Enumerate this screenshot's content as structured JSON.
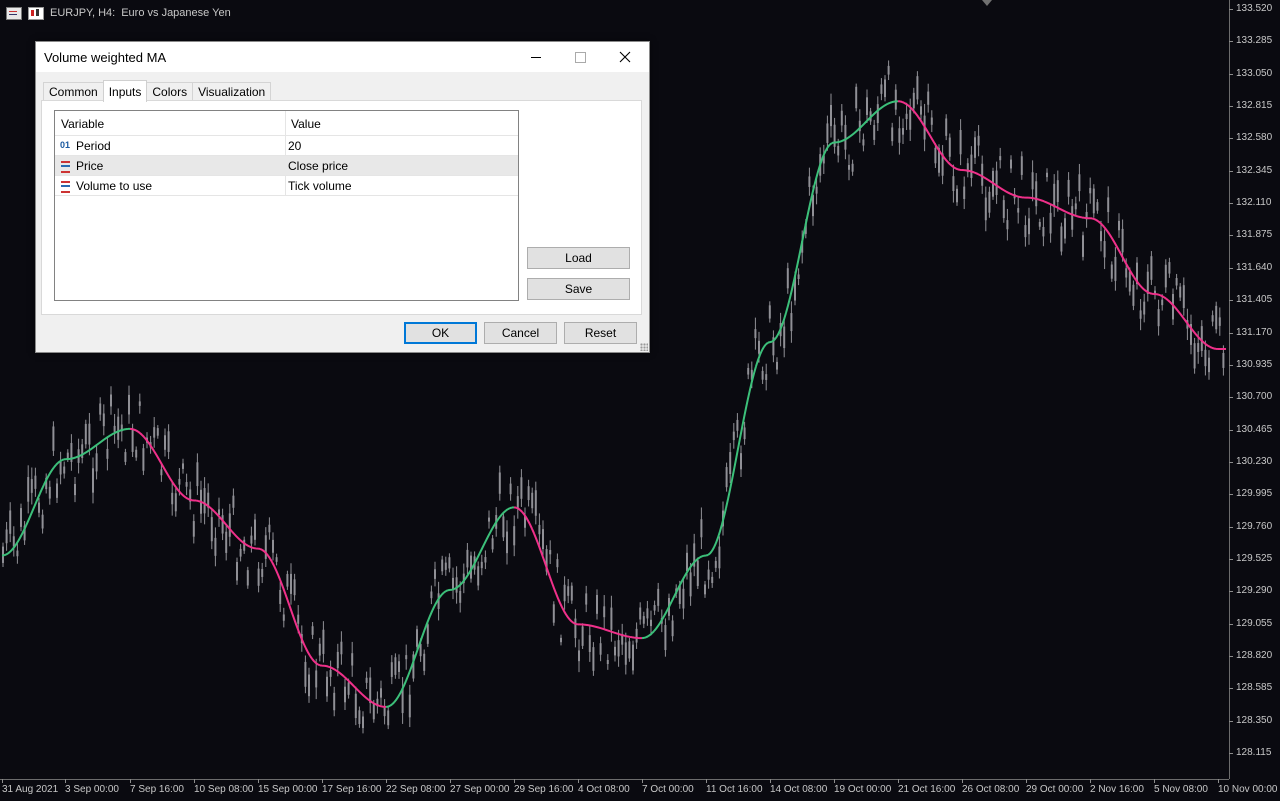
{
  "chart": {
    "symbol": "EURJPY, H4:",
    "description": "Euro vs Japanese Yen",
    "price_labels": [
      "133.520",
      "133.285",
      "133.050",
      "132.815",
      "132.580",
      "132.345",
      "132.110",
      "131.875",
      "131.640",
      "131.405",
      "131.170",
      "130.935",
      "130.700",
      "130.465",
      "130.230",
      "129.995",
      "129.760",
      "129.525",
      "129.290",
      "129.055",
      "128.820",
      "128.585",
      "128.350",
      "128.115"
    ],
    "time_labels": [
      "31 Aug 2021",
      "3 Sep 00:00",
      "7 Sep 16:00",
      "10 Sep 08:00",
      "15 Sep 00:00",
      "17 Sep 16:00",
      "22 Sep 08:00",
      "27 Sep 00:00",
      "29 Sep 16:00",
      "4 Oct 08:00",
      "7 Oct 00:00",
      "11 Oct 16:00",
      "14 Oct 08:00",
      "19 Oct 00:00",
      "21 Oct 16:00",
      "26 Oct 08:00",
      "29 Oct 00:00",
      "2 Nov 16:00",
      "5 Nov 08:00",
      "10 Nov 00:00"
    ],
    "colors": {
      "background": "#0a0a10",
      "candle": "#909096",
      "ma_up": "#3cc07a",
      "ma_down": "#f0308a"
    }
  },
  "chart_data": {
    "type": "line",
    "title": "EURJPY, H4: Euro vs Japanese Yen",
    "x_range": [
      "31 Aug 2021",
      "10 Nov 00:00"
    ],
    "ylim": [
      128.0,
      133.6
    ],
    "series": [
      {
        "name": "Volume weighted MA",
        "points": [
          [
            "31 Aug 2021",
            129.55
          ],
          [
            "3 Sep 00:00",
            130.25
          ],
          [
            "7 Sep 16:00",
            130.47
          ],
          [
            "10 Sep 08:00",
            129.95
          ],
          [
            "15 Sep 00:00",
            129.6
          ],
          [
            "17 Sep 16:00",
            128.75
          ],
          [
            "22 Sep 08:00",
            128.45
          ],
          [
            "27 Sep 00:00",
            129.3
          ],
          [
            "29 Sep 16:00",
            129.9
          ],
          [
            "4 Oct 08:00",
            129.05
          ],
          [
            "7 Oct 00:00",
            128.95
          ],
          [
            "11 Oct 16:00",
            129.55
          ],
          [
            "14 Oct 08:00",
            131.1
          ],
          [
            "19 Oct 00:00",
            132.55
          ],
          [
            "21 Oct 16:00",
            132.85
          ],
          [
            "26 Oct 08:00",
            132.35
          ],
          [
            "29 Oct 00:00",
            132.15
          ],
          [
            "2 Nov 16:00",
            132.0
          ],
          [
            "5 Nov 08:00",
            131.45
          ],
          [
            "10 Nov 00:00",
            131.05
          ]
        ]
      }
    ],
    "grid": false
  },
  "dialog": {
    "title": "Volume weighted MA",
    "tabs": [
      "Common",
      "Inputs",
      "Colors",
      "Visualization"
    ],
    "active_tab": "Inputs",
    "columns": {
      "variable": "Variable",
      "value": "Value"
    },
    "rows": [
      {
        "icon": "01",
        "variable": "Period",
        "value": "20"
      },
      {
        "icon": "list-icon",
        "variable": "Price",
        "value": "Close price"
      },
      {
        "icon": "list-icon",
        "variable": "Volume to use",
        "value": "Tick volume"
      }
    ],
    "buttons": {
      "load": "Load",
      "save": "Save",
      "ok": "OK",
      "cancel": "Cancel",
      "reset": "Reset"
    }
  }
}
